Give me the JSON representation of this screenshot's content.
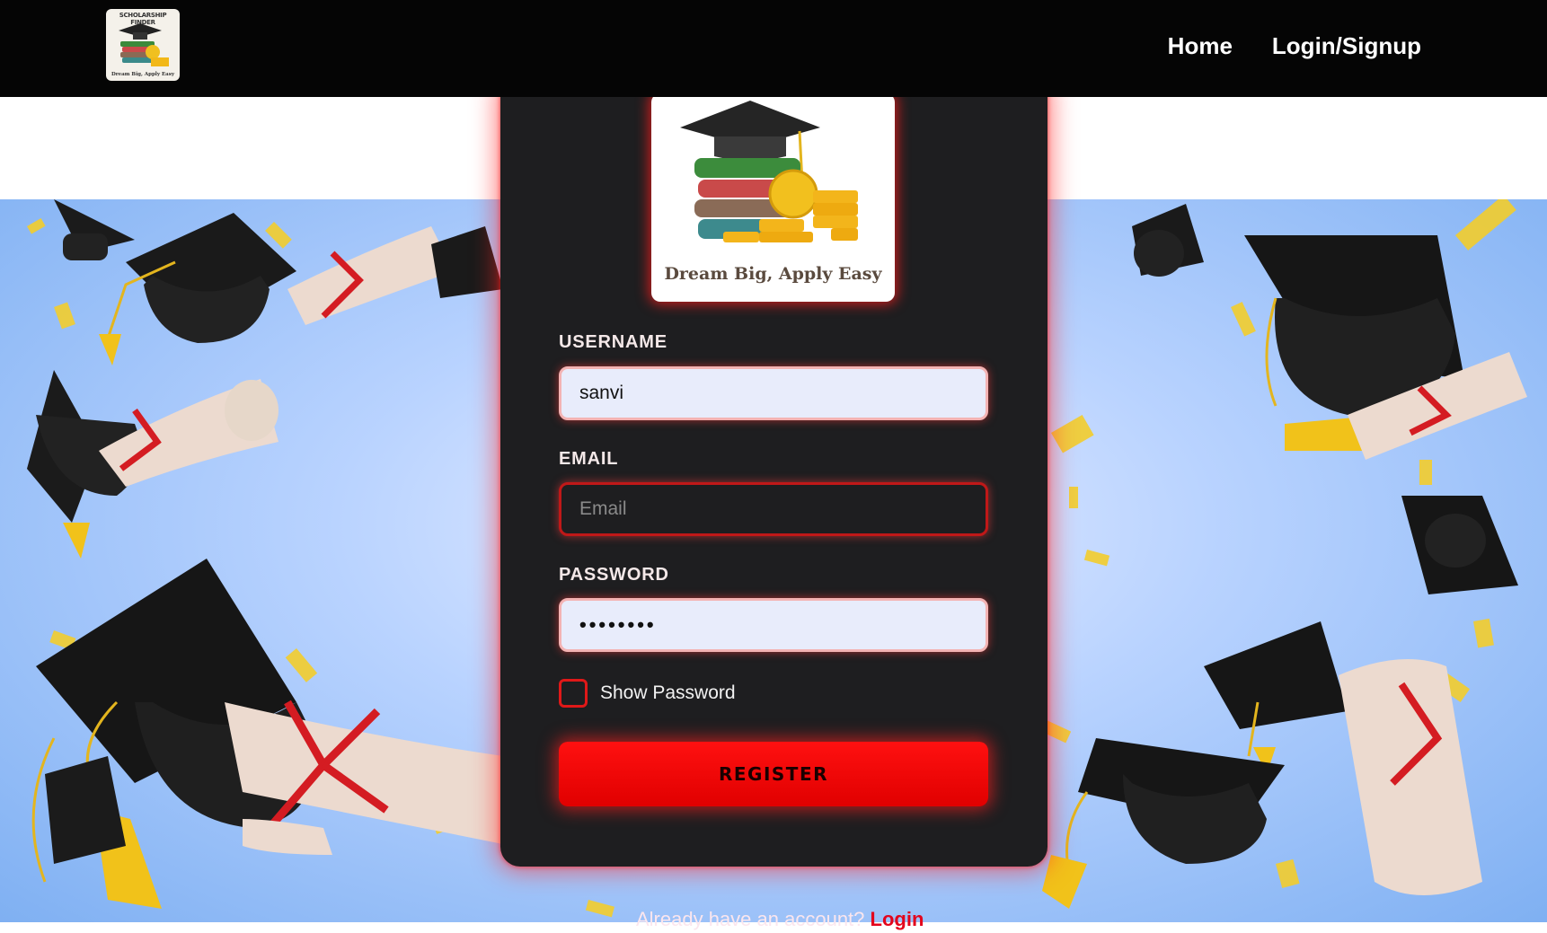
{
  "nav": {
    "logo_brand": "SCHOLARSHIP FINDER",
    "logo_tagline": "Dream Big, Apply Easy",
    "links": [
      "Home",
      "Login/Signup"
    ]
  },
  "card": {
    "logo_tagline": "Dream Big, Apply Easy",
    "username": {
      "label": "USERNAME",
      "value": "sanvi"
    },
    "email": {
      "label": "EMAIL",
      "value": "",
      "placeholder": "Email"
    },
    "password": {
      "label": "PASSWORD",
      "value": "••••••••"
    },
    "show_password_label": "Show Password",
    "register_label": "REGISTER"
  },
  "footer": {
    "prompt": "Already have an account? ",
    "login_link": "Login"
  },
  "colors": {
    "accent": "#e00000",
    "nav_bg": "#050505",
    "card_bg": "#1e1e20"
  }
}
